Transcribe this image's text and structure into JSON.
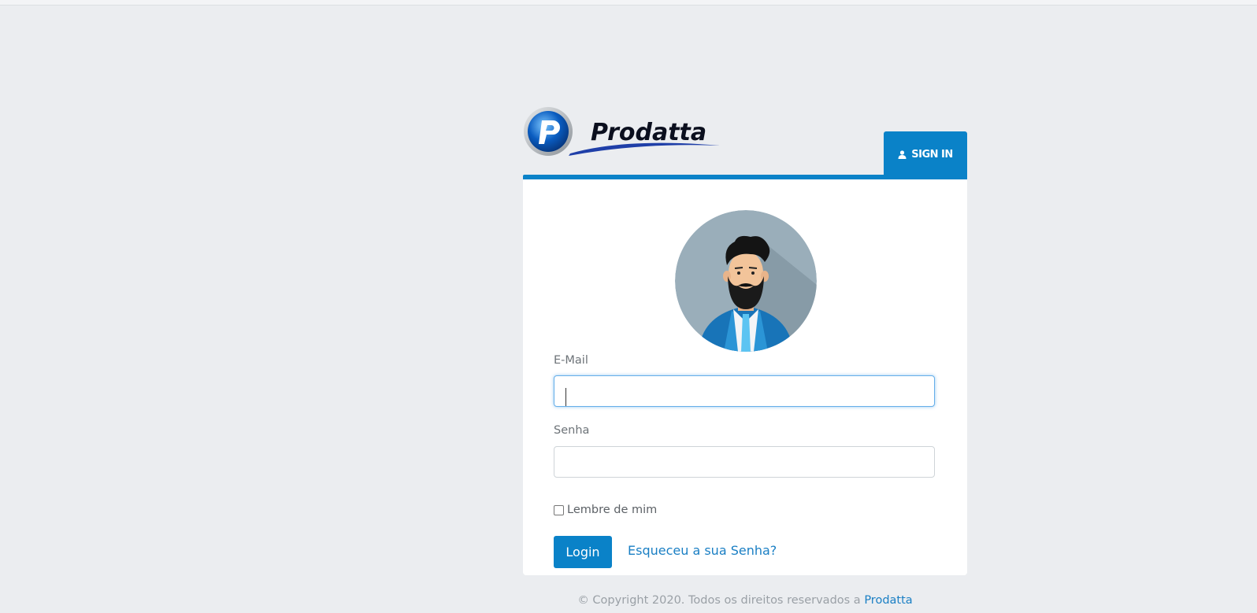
{
  "brand": {
    "logo_text": "Prodatta",
    "accent_color": "#0a82c8"
  },
  "tab": {
    "label": "SIGN IN",
    "icon": "user-icon"
  },
  "avatar": {
    "icon": "bearded-man-avatar"
  },
  "form": {
    "email_label": "E-Mail",
    "email_value": "",
    "password_label": "Senha",
    "password_value": "",
    "remember_label": "Lembre de mim",
    "remember_checked": false,
    "login_label": "Login",
    "forgot_label": "Esqueceu a sua Senha?"
  },
  "footer": {
    "copyright_text": "© Copyright 2020. Todos os direitos reservados a ",
    "company_link": "Prodatta"
  }
}
